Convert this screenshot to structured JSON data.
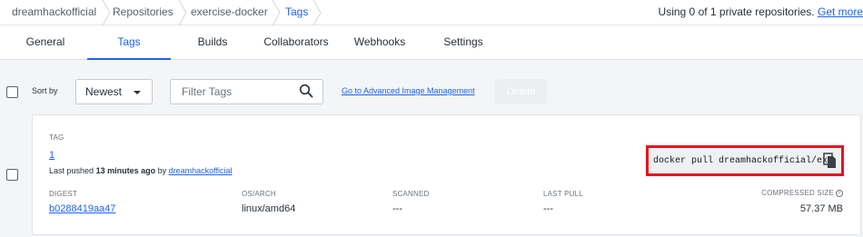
{
  "breadcrumb": {
    "items": [
      "dreamhackofficial",
      "Repositories",
      "exercise-docker",
      "Tags"
    ]
  },
  "usage": {
    "text": "Using 0 of 1 private repositories.",
    "link": "Get more"
  },
  "tabs": [
    "General",
    "Tags",
    "Builds",
    "Collaborators",
    "Webhooks",
    "Settings"
  ],
  "active_tab": "Tags",
  "toolbar": {
    "sort_label": "Sort by",
    "sort_value": "Newest",
    "filter_placeholder": "Filter Tags",
    "advanced_link": "Go to Advanced Image Management",
    "delete_label": "Delete"
  },
  "tag_card": {
    "tag_header": "TAG",
    "tag_name": "1",
    "pushed_prefix": "Last pushed",
    "pushed_time": "13 minutes ago",
    "pushed_by_prefix": "by",
    "pushed_by": "dreamhackofficial",
    "pull_command": "docker pull dreamhackofficial/ex…",
    "columns": {
      "digest": "DIGEST",
      "os_arch": "OS/ARCH",
      "scanned": "SCANNED",
      "last_pull": "LAST PULL",
      "compressed_size": "COMPRESSED SIZE"
    },
    "row": {
      "digest": "b0288419aa47",
      "os_arch": "linux/amd64",
      "scanned": "---",
      "last_pull": "---",
      "compressed_size": "57.37 MB"
    }
  },
  "colors": {
    "accent": "#1d63ed",
    "highlight": "#e3161d"
  }
}
